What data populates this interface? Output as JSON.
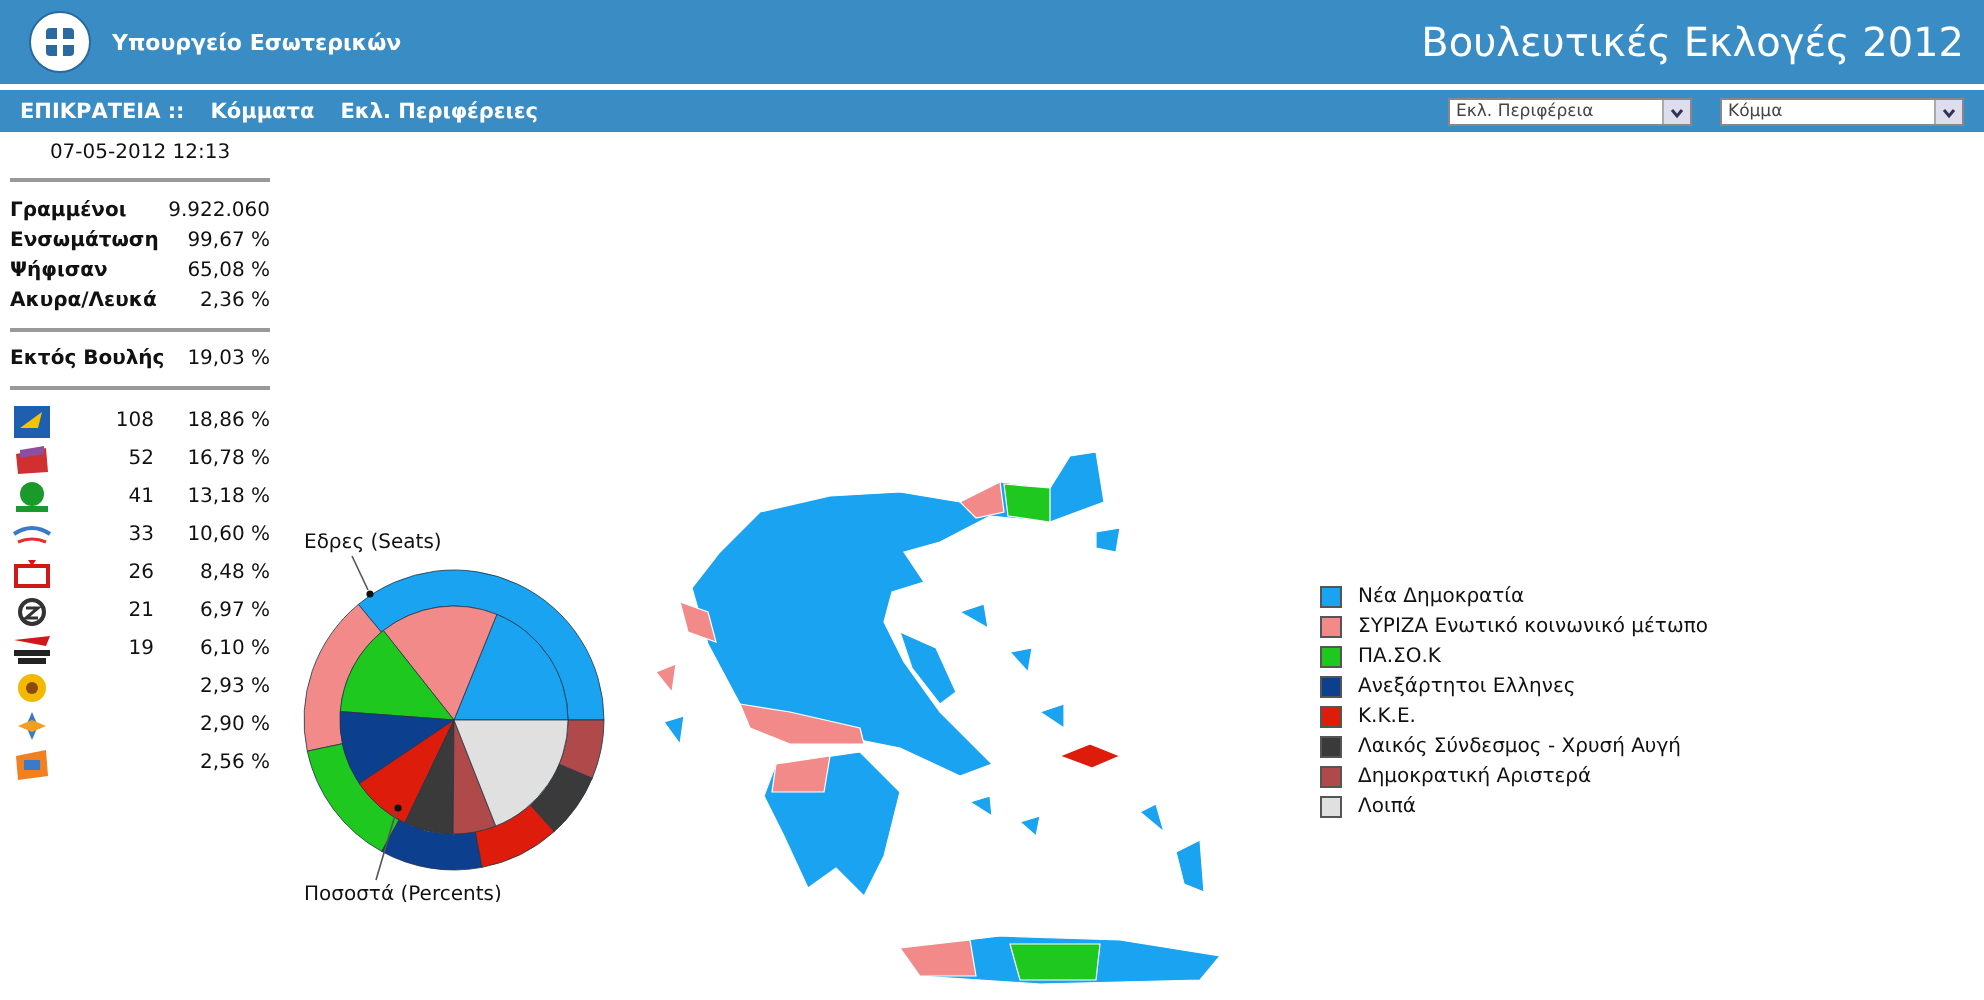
{
  "header": {
    "ministry": "Υπουργείο Εσωτερικών",
    "title": "Βουλευτικές Εκλογές 2012"
  },
  "nav": {
    "items": [
      "ΕΠΙΚΡΑΤΕΙΑ ::",
      "Κόμματα",
      "Εκλ. Περιφέρειες"
    ],
    "selects": [
      {
        "value": "Εκλ. Περιφέρεια"
      },
      {
        "value": "Κόμμα"
      }
    ]
  },
  "summary": {
    "timestamp": "07-05-2012 12:13",
    "stats": [
      {
        "label": "Γραμμένοι",
        "value": "9.922.060"
      },
      {
        "label": "Ενσωμάτωση",
        "value": "99,67 %"
      },
      {
        "label": "Ψήφισαν",
        "value": "65,08 %"
      },
      {
        "label": "Ακυρα/Λευκά",
        "value": "2,36 %"
      }
    ],
    "outside": {
      "label": "Εκτός Βουλής",
      "value": "19,03 %"
    }
  },
  "parties": [
    {
      "kind": "nd",
      "seats": "108",
      "percent": "18,86 %"
    },
    {
      "kind": "syriza",
      "seats": "52",
      "percent": "16,78 %"
    },
    {
      "kind": "pasok",
      "seats": "41",
      "percent": "13,18 %"
    },
    {
      "kind": "anel",
      "seats": "33",
      "percent": "10,60 %"
    },
    {
      "kind": "kke",
      "seats": "26",
      "percent": "8,48 %"
    },
    {
      "kind": "xa",
      "seats": "21",
      "percent": "6,97 %"
    },
    {
      "kind": "dimar",
      "seats": "19",
      "percent": "6,10 %"
    },
    {
      "kind": "sun",
      "percent": "2,93 %"
    },
    {
      "kind": "cross",
      "percent": "2,90 %"
    },
    {
      "kind": "flag",
      "percent": "2,56 %"
    }
  ],
  "chart": {
    "seats_label": "Εδρες (Seats)",
    "percents_label": "Ποσοστά (Percents)"
  },
  "legend": [
    {
      "label": "Νέα Δημοκρατία",
      "color": "#1aa3f0"
    },
    {
      "label": "ΣΥΡΙΖΑ Ενωτικό κοινωνικό μέτωπο",
      "color": "#f28a8a"
    },
    {
      "label": "ΠΑ.ΣΟ.Κ",
      "color": "#1ec81e"
    },
    {
      "label": "Ανεξάρτητοι Ελληνες",
      "color": "#0d3f8f"
    },
    {
      "label": "Κ.Κ.Ε.",
      "color": "#dd1c0c"
    },
    {
      "label": "Λαικός Σύνδεσμος - Χρυσή Αυγή",
      "color": "#3a3a3a"
    },
    {
      "label": "Δημοκρατική Αριστερά",
      "color": "#b04a4a"
    },
    {
      "label": "Λοιπά",
      "color": "#e0e0e0"
    }
  ]
}
